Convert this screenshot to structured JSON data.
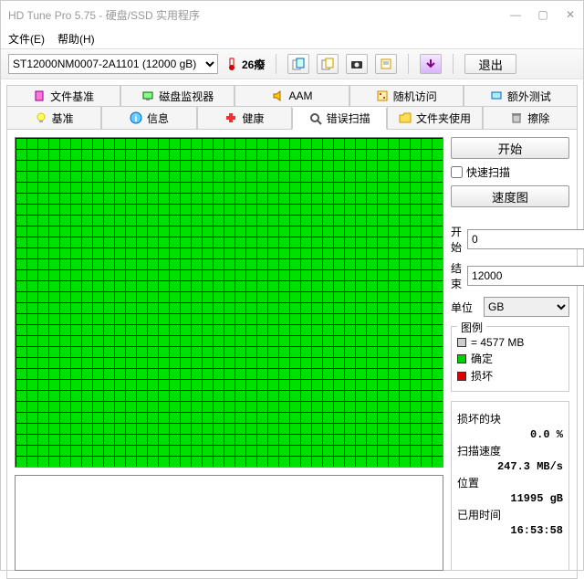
{
  "window": {
    "title": "HD Tune Pro 5.75 - 硬盘/SSD 实用程序"
  },
  "menu": {
    "file": "文件(E)",
    "help": "帮助(H)"
  },
  "toolbar": {
    "device": "ST12000NM0007-2A1101 (12000 gB)",
    "temperature": "26癈",
    "exit": "退出"
  },
  "tabs": {
    "row1": {
      "file_bench": "文件基准",
      "disk_monitor": "磁盘监视器",
      "aam": "AAM",
      "random_access": "随机访问",
      "extra_tests": "额外测试"
    },
    "row2": {
      "benchmark": "基准",
      "info": "信息",
      "health": "健康",
      "error_scan": "错误扫描",
      "folder_usage": "文件夹使用",
      "erase": "擦除"
    }
  },
  "panel": {
    "start_btn": "开始",
    "quick_scan": "快速扫描",
    "speed_map": "速度图",
    "start_label": "开始",
    "start_value": "0",
    "end_label": "结束",
    "end_value": "12000",
    "unit_label": "单位",
    "unit_value": "GB",
    "legend": {
      "title": "图例",
      "block_size": "= 4577 MB",
      "ok": "确定",
      "damaged": "损坏"
    },
    "stats": {
      "damaged_blocks_label": "损坏的块",
      "damaged_blocks": "0.0 %",
      "scan_speed_label": "扫描速度",
      "scan_speed": "247.3 MB/s",
      "position_label": "位置",
      "position": "11995 gB",
      "elapsed_label": "已用时间",
      "elapsed": "16:53:58"
    }
  }
}
